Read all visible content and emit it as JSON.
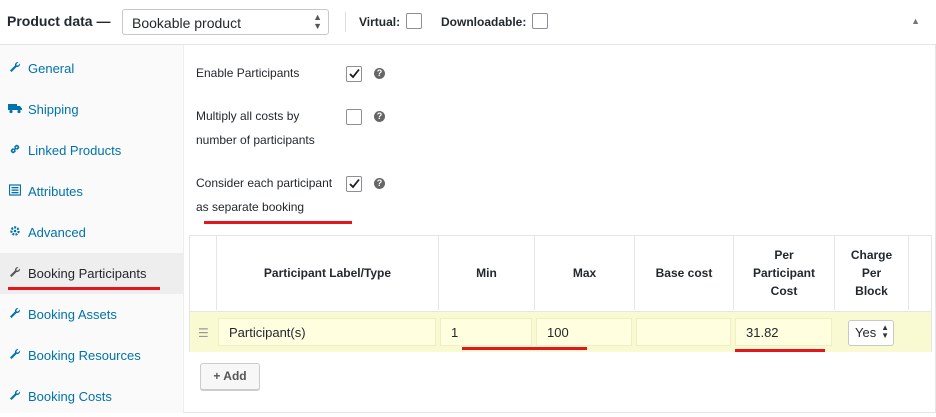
{
  "header": {
    "title": "Product data —",
    "product_type": "Bookable product",
    "virtual_label": "Virtual:",
    "downloadable_label": "Downloadable:"
  },
  "sidebar": {
    "items": [
      {
        "label": "General",
        "icon": "wrench-icon"
      },
      {
        "label": "Shipping",
        "icon": "truck-icon"
      },
      {
        "label": "Linked Products",
        "icon": "link-icon"
      },
      {
        "label": "Attributes",
        "icon": "list-icon"
      },
      {
        "label": "Advanced",
        "icon": "gear-icon"
      },
      {
        "label": "Booking Participants",
        "icon": "wrench-icon"
      },
      {
        "label": "Booking Assets",
        "icon": "wrench-icon"
      },
      {
        "label": "Booking Resources",
        "icon": "wrench-icon"
      },
      {
        "label": "Booking Costs",
        "icon": "wrench-icon"
      }
    ],
    "active": "Booking Participants"
  },
  "options": {
    "enable_participants": {
      "label": "Enable Participants",
      "checked": true
    },
    "multiply_costs": {
      "label_line1": "Multiply all costs by",
      "label_line2": "number of participants",
      "checked": false
    },
    "separate_booking": {
      "label_line1": "Consider each participant",
      "label_line2": "as separate booking",
      "checked": true
    }
  },
  "table": {
    "headers": {
      "label_type": "Participant Label/Type",
      "min": "Min",
      "max": "Max",
      "base_cost": "Base cost",
      "per_participant_cost": [
        "Per",
        "Participant",
        "Cost"
      ],
      "charge_per_block": [
        "Charge",
        "Per",
        "Block"
      ]
    },
    "rows": [
      {
        "label": "Participant(s)",
        "min": "1",
        "max": "100",
        "base_cost": "",
        "per_participant_cost": "31.82",
        "charge_per_block": "Yes"
      }
    ]
  },
  "add_button": "+ Add",
  "colors": {
    "link": "#0073aa",
    "highlight_row": "#fafad2",
    "annotation": "#e4151c"
  }
}
